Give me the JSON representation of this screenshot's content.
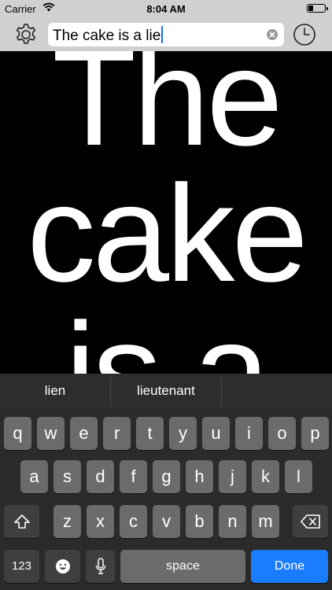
{
  "status_bar": {
    "carrier": "Carrier",
    "time": "8:04 AM"
  },
  "toolbar": {
    "search_value": "The cake is a lie",
    "icons": [
      "gear-icon",
      "clear-icon",
      "clock-icon"
    ]
  },
  "display": {
    "lines": [
      "The",
      "cake",
      "is a"
    ]
  },
  "keyboard": {
    "suggestions": [
      "lien",
      "lieutenant",
      ""
    ],
    "row1": [
      "q",
      "w",
      "e",
      "r",
      "t",
      "y",
      "u",
      "i",
      "o",
      "p"
    ],
    "row2": [
      "a",
      "s",
      "d",
      "f",
      "g",
      "h",
      "j",
      "k",
      "l"
    ],
    "row3": [
      "z",
      "x",
      "c",
      "v",
      "b",
      "n",
      "m"
    ],
    "numbers_label": "123",
    "space_label": "space",
    "done_label": "Done",
    "done_color": "#1a7cff"
  }
}
